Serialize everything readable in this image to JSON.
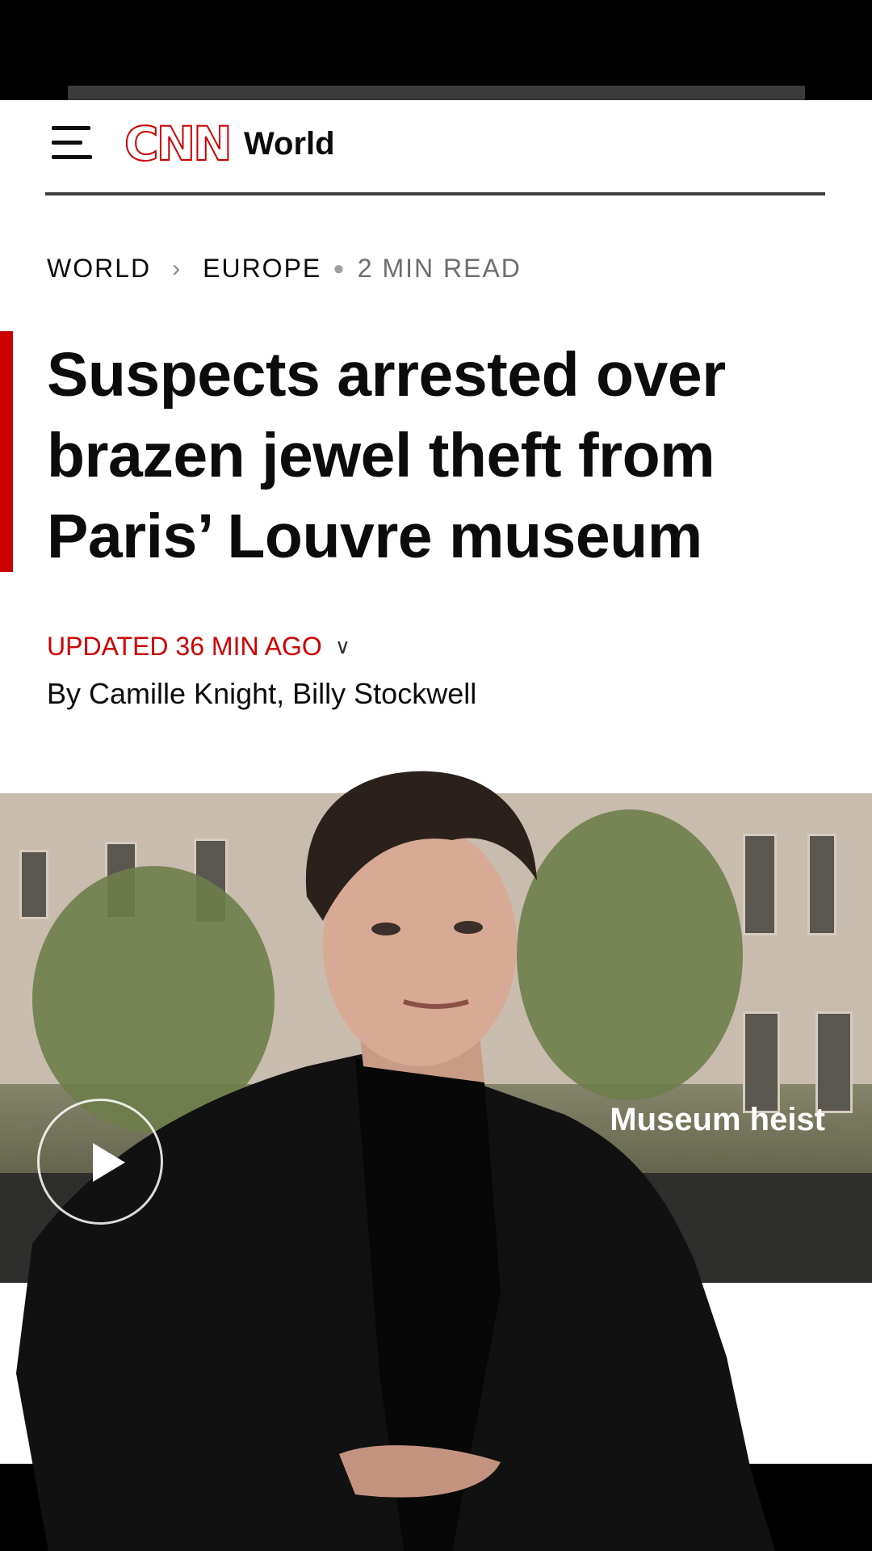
{
  "header": {
    "menu_icon": "hamburger-menu-icon",
    "logo_text": "CNN",
    "section": "World"
  },
  "breadcrumb": {
    "primary": "WORLD",
    "secondary": "EUROPE",
    "read_time": "2 MIN READ"
  },
  "article": {
    "headline": "Suspects arrested over brazen jewel theft from Paris’ Louvre museum",
    "updated": "UPDATED 36 MIN AGO",
    "byline_prefix": "By",
    "authors": [
      "Camille Knight",
      "Billy Stockwell"
    ]
  },
  "video": {
    "caption": "Museum heist",
    "play_icon": "play-icon"
  },
  "colors": {
    "brand_red": "#cc0000",
    "text": "#0c0c0c"
  }
}
